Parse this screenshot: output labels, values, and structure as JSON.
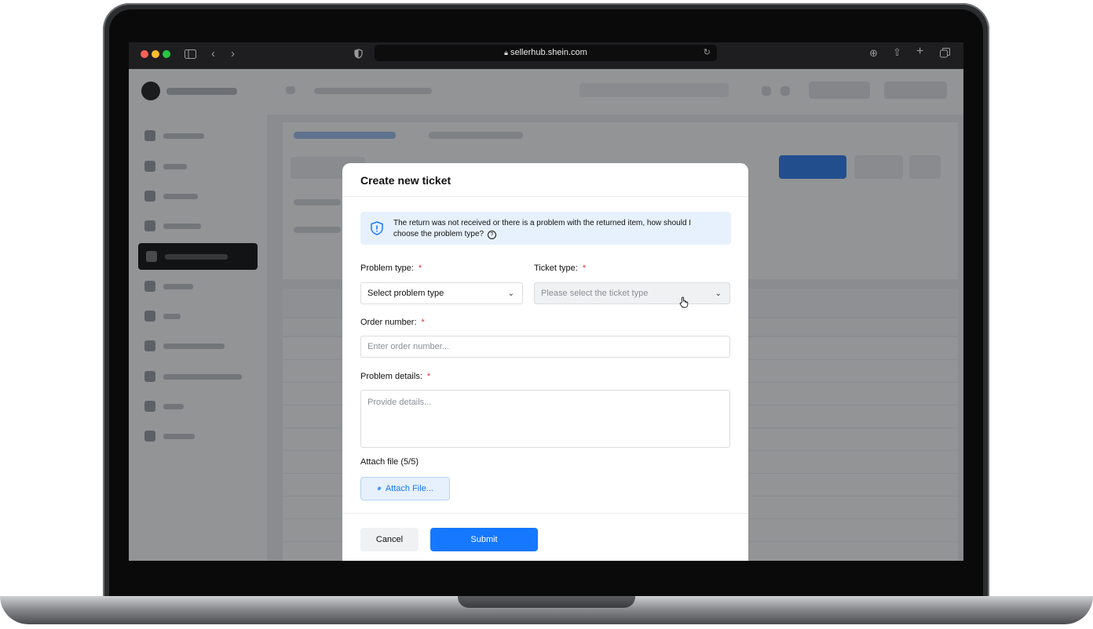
{
  "browser": {
    "url": "sellerhub.shein.com",
    "traffic_lights": [
      "#ff5f57",
      "#febc2e",
      "#28c840"
    ]
  },
  "modal": {
    "title": "Create new ticket",
    "info_text": "The return was not received or there is a problem with the returned item, how should I choose the problem type?",
    "problem_type": {
      "label": "Problem type:",
      "required_mark": "*",
      "value": "Select problem type"
    },
    "ticket_type": {
      "label": "Ticket type:",
      "required_mark": "*",
      "placeholder": "Please select the ticket type"
    },
    "order_number": {
      "label": "Order number:",
      "required_mark": "*",
      "placeholder": "Enter order number..."
    },
    "problem_details": {
      "label": "Problem details:",
      "required_mark": "*",
      "placeholder": "Provide details..."
    },
    "attach": {
      "label": "Attach file (5/5)",
      "button_label": "Attach File..."
    },
    "cancel_label": "Cancel",
    "submit_label": "Submit"
  },
  "colors": {
    "accent": "#1677ff",
    "info_bg": "#e7f1fd",
    "required": "#e03131"
  }
}
